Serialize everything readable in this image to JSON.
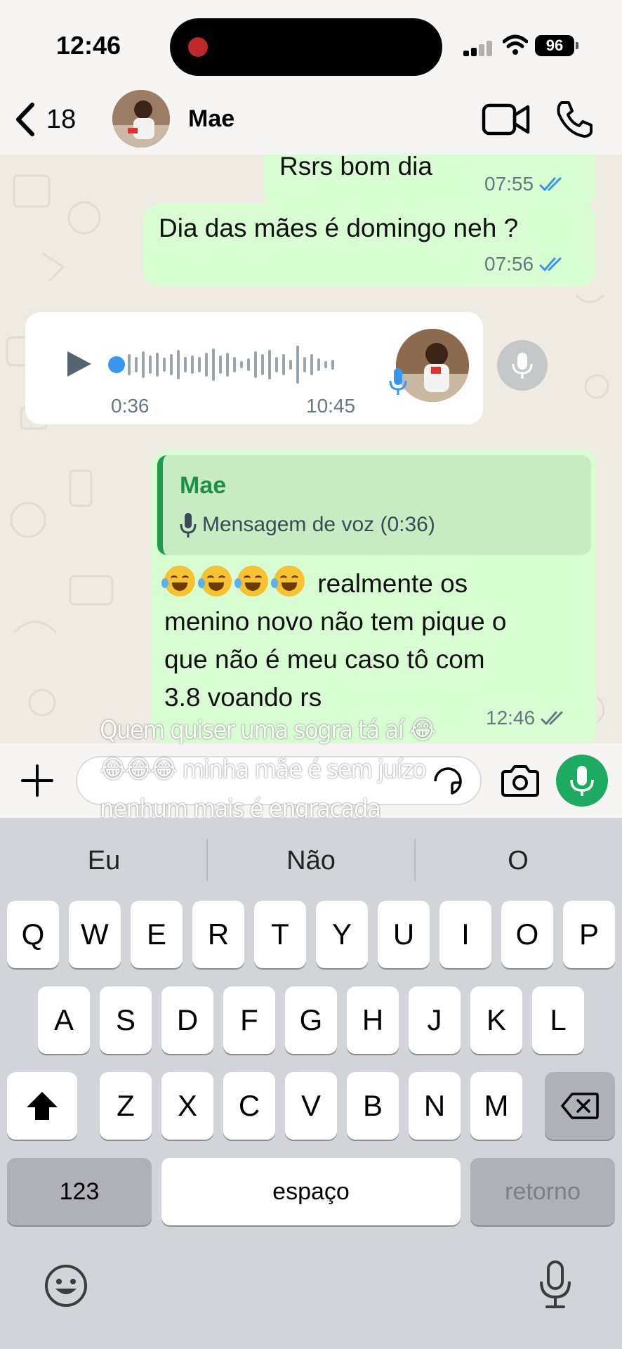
{
  "status_bar": {
    "time": "12:46",
    "battery": "96"
  },
  "header": {
    "back_count": "18",
    "contact_name": "Mae"
  },
  "messages": {
    "m1": {
      "text": "Rsrs bom dia",
      "time": "07:55"
    },
    "m2": {
      "text": "Dia das mães é domingo neh ?",
      "time": "07:56"
    },
    "voice": {
      "position": "0:36",
      "time": "10:45"
    },
    "reply": {
      "quoted_name": "Mae",
      "quoted_text": "Mensagem de voz (0:36)",
      "line1": "realmente os",
      "line2": "menino novo não tem pique o",
      "line3": "que não é meu caso tô com",
      "line4": "3.8 voando rs",
      "time": "12:46"
    }
  },
  "caption": {
    "line1": "Quem quiser uma sogra tá aí 😂",
    "line2": "😂😂😂 minha mãe é sem juízo",
    "line3": "nenhum mais é engraçada"
  },
  "keyboard": {
    "suggestions": [
      "Eu",
      "Não",
      "O"
    ],
    "row1": [
      "Q",
      "W",
      "E",
      "R",
      "T",
      "Y",
      "U",
      "I",
      "O",
      "P"
    ],
    "row2": [
      "A",
      "S",
      "D",
      "F",
      "G",
      "H",
      "J",
      "K",
      "L"
    ],
    "row3": [
      "Z",
      "X",
      "C",
      "V",
      "B",
      "N",
      "M"
    ],
    "numbers_label": "123",
    "space_label": "espaço",
    "return_label": "retorno"
  },
  "colors": {
    "accent": "#1daa61",
    "outgoing_bubble": "#d9fdd3",
    "read_tick": "#3796f0"
  }
}
